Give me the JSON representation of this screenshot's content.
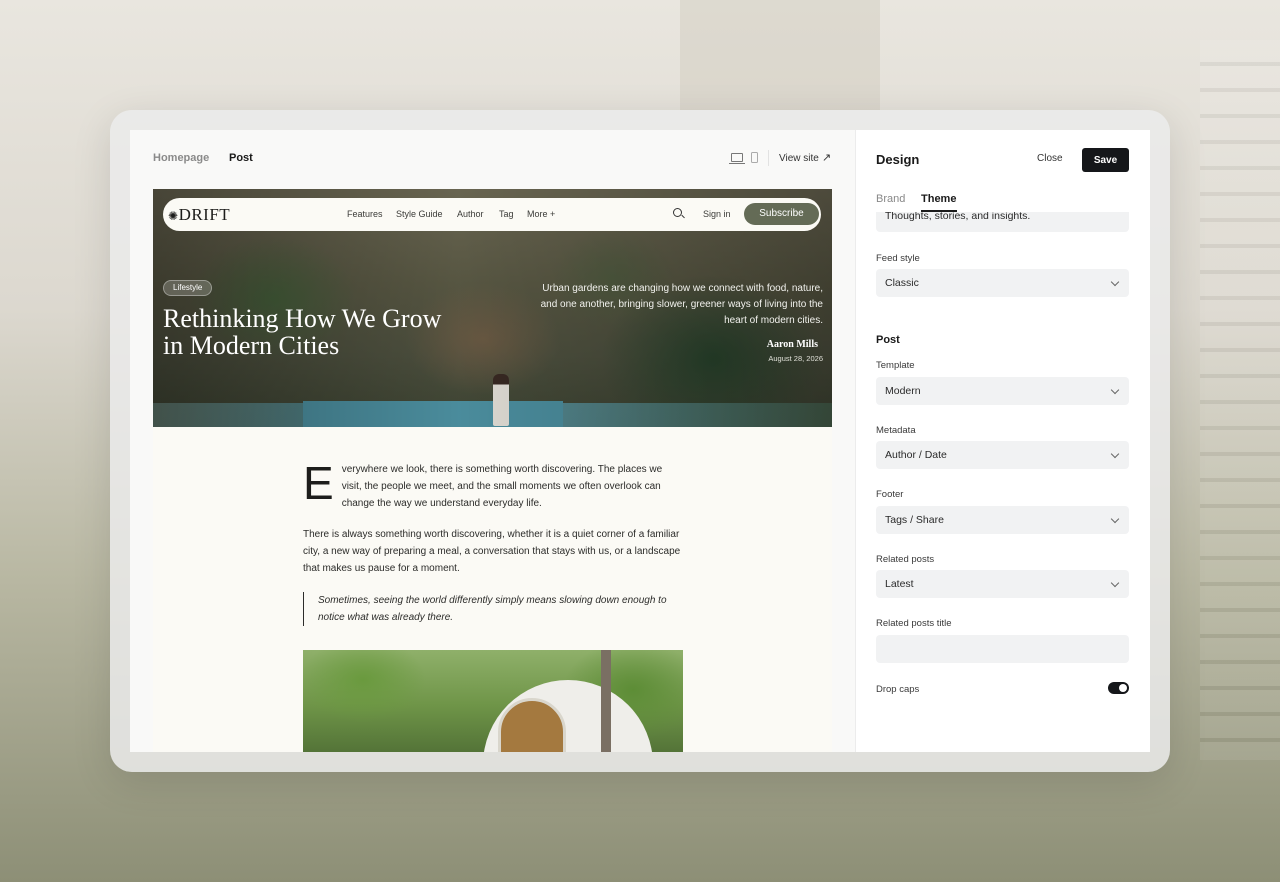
{
  "preview_toolbar": {
    "tabs": [
      "Homepage",
      "Post"
    ],
    "view_site": "View site",
    "view_site_arrow": "↗"
  },
  "site": {
    "logo": "DRIFT",
    "logo_mark": "✺",
    "nav": [
      "Features",
      "Style Guide",
      "Author",
      "Tag",
      "More +"
    ],
    "sign_in": "Sign in",
    "subscribe": "Subscribe"
  },
  "hero": {
    "tag": "Lifestyle",
    "title": "Rethinking How We Grow in Modern Cities",
    "excerpt": "Urban gardens are changing how we connect with food, nature, and one another, bringing slower, greener ways of living into the heart of modern cities.",
    "author": "Aaron Mills",
    "date": "August 28, 2026"
  },
  "article": {
    "dropcap": "E",
    "para1": "verywhere we look, there is something worth discovering. The places we visit, the people we meet, and the small moments we often overlook can change the way we understand everyday life.",
    "para2": "There is always something worth discovering, whether it is a quiet corner of a familiar city, a new way of preparing a meal, a conversation that stays with us, or a landscape that makes us pause for a moment.",
    "quote": "Sometimes, seeing the world differently simply means slowing down enough to notice what was already there."
  },
  "sidebar": {
    "title": "Design",
    "close": "Close",
    "save": "Save",
    "tabs": [
      "Brand",
      "Theme"
    ],
    "description_value": "Thoughts, stories, and insights.",
    "feed_style": {
      "label": "Feed style",
      "value": "Classic"
    },
    "post_section": "Post",
    "template": {
      "label": "Template",
      "value": "Modern"
    },
    "metadata": {
      "label": "Metadata",
      "value": "Author / Date"
    },
    "footer": {
      "label": "Footer",
      "value": "Tags / Share"
    },
    "related_posts": {
      "label": "Related posts",
      "value": "Latest"
    },
    "related_posts_title": {
      "label": "Related posts title",
      "value": ""
    },
    "drop_caps": {
      "label": "Drop caps",
      "enabled": true
    }
  },
  "colors": {
    "accent_button": "#15171a",
    "subscribe": "#646b56"
  }
}
